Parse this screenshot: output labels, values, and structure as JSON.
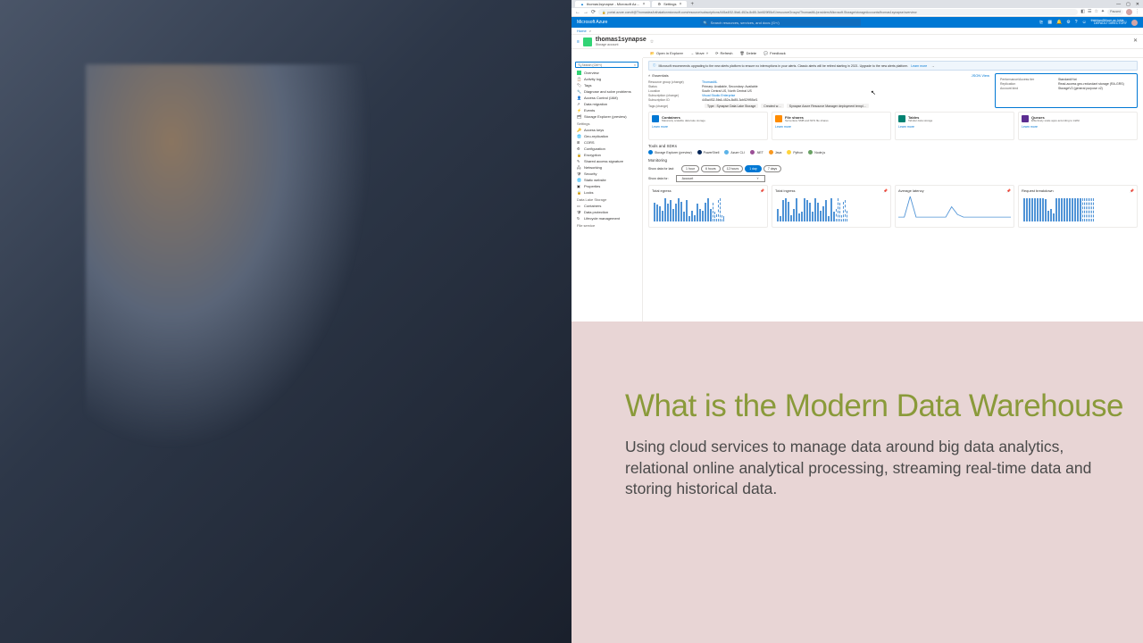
{
  "slide": {
    "headline": "What is the Modern Data Warehouse",
    "subhead": "Using cloud services to manage data around big data analytics, relational online analytical processing, streaming real-time data and storing historical data."
  },
  "browser": {
    "tab1": "thomas1synapse - Microsoft Az…",
    "tab2": "Settings",
    "url": "portal.azure.com/#@ThomasleaAnthalationmicrosoft.com/resource/subscriptions/445a4f32-5fa6-452a-8c85-3cb529f55cf1/resourceGroups/ThomasML/providers/Microsoft.Storage/storageAccounts/thomas1synapse/overview",
    "paused": "Paused"
  },
  "azure": {
    "brand": "Microsoft Azure",
    "search_ph": "Search resources, services, and docs (G+/)",
    "user_name": "thleblan@thom.ac-inbla…",
    "user_dir": "DEFAULT DIRECTORY"
  },
  "crumb": {
    "home": "Home",
    "sep": ">"
  },
  "resource": {
    "name": "thomas1synapse",
    "type": "Storage account"
  },
  "toolbar": {
    "open": "Open in Explorer",
    "move": "Move",
    "refresh": "Refresh",
    "delete": "Delete",
    "feedback": "Feedback"
  },
  "sidebar": {
    "search_ph": "Search (Ctrl+/)",
    "overview": "Overview",
    "activity": "Activity log",
    "tags": "Tags",
    "diagnose": "Diagnose and solve problems",
    "iam": "Access Control (IAM)",
    "migration": "Data migration",
    "events": "Events",
    "explorer": "Storage Explorer (preview)",
    "g_settings": "Settings",
    "keys": "Access keys",
    "geo": "Geo-replication",
    "cors": "CORS",
    "config": "Configuration",
    "encryption": "Encryption",
    "sas": "Shared access signature",
    "networking": "Networking",
    "security": "Security",
    "static": "Static website",
    "properties": "Properties",
    "locks": "Locks",
    "g_dls": "Data Lake Storage",
    "containers": "Containers",
    "dataprotect": "Data protection",
    "lifecycle": "Lifecycle management",
    "g_fs": "File service"
  },
  "alert": {
    "text": "Microsoft recommends upgrading to the new alerts platform to ensure no interruptions in your alerts. Classic alerts will be retired starting in 2021. Upgrade to the new alerts platform.",
    "link": "Learn more"
  },
  "essentials": {
    "header": "Essentials",
    "json": "JSON View",
    "rg_k": "Resource group (change)",
    "rg_v": "ThomasML",
    "status_k": "Status",
    "status_v": "Primary: Available, Secondary: Available",
    "loc_k": "Location",
    "loc_v": "South Central US, North Central US",
    "sub_k": "Subscription (change)",
    "sub_v": "Visual Studio Enterprise",
    "subid_k": "Subscription ID",
    "subid_v": "445a4f32-5fa6-452a-8c85-3cb529f55cf1",
    "tags_k": "Tags (change)",
    "tag1": "Type : Synapse Data Lake Storage",
    "tag2": "Created w…",
    "tag3": "Synapse Azure Resource Manager deployment templ…"
  },
  "callout": {
    "perf_k": "Performance/Access tier",
    "perf_v": "Standard/Hot",
    "repl_k": "Replication",
    "repl_v": "Read-access geo-redundant storage (RA-GRS)",
    "kind_k": "Account kind",
    "kind_v": "StorageV2 (general purpose v2)"
  },
  "cards": {
    "c1_t": "Containers",
    "c1_d": "Massively scalable data lake storage",
    "c1_l": "Learn more",
    "c2_t": "File shares",
    "c2_d": "Serverless SMB and NFS file shares",
    "c2_l": "Learn more",
    "c3_t": "Tables",
    "c3_d": "Tabular data storage",
    "c3_l": "Learn more",
    "c4_t": "Queues",
    "c4_d": "Effectively scale apps according to traffic",
    "c4_l": "Learn more"
  },
  "tools": {
    "header": "Tools and SDKs",
    "se": "Storage Explorer (preview)",
    "ps": "PowerShell",
    "cli": "Azure CLI",
    "net": ".NET",
    "java": "Java",
    "py": "Python",
    "node": "Node.js"
  },
  "monitoring": {
    "header": "Monitoring",
    "showlast": "Show data for last:",
    "t1": "1 hour",
    "t2": "6 hours",
    "t3": "12 hours",
    "t4": "1 day",
    "t5": "7 days",
    "showfor": "Show data for:",
    "agg": "Account"
  },
  "charts": {
    "c1": "Total egress",
    "c2": "Total ingress",
    "c3": "Average latency",
    "c4": "Request breakdown"
  },
  "chart_data": [
    {
      "type": "bar",
      "title": "Total egress",
      "values": [
        18,
        16,
        14,
        10,
        22,
        17,
        20,
        12,
        17,
        22,
        19,
        9,
        20,
        5,
        10,
        6,
        17,
        12,
        10,
        18,
        22,
        12,
        18,
        9,
        7,
        20,
        22,
        6,
        5
      ]
    },
    {
      "type": "bar",
      "title": "Total ingress",
      "values": [
        12,
        5,
        20,
        22,
        19,
        6,
        12,
        22,
        8,
        9,
        22,
        20,
        18,
        9,
        22,
        18,
        10,
        14,
        20,
        5,
        22,
        9,
        12,
        22,
        18,
        6,
        19,
        20,
        10
      ]
    },
    {
      "type": "line",
      "title": "Average latency",
      "values": [
        2,
        2,
        18,
        2,
        2,
        2,
        2,
        2,
        2,
        10,
        4,
        2,
        2,
        2,
        2,
        2,
        2,
        2,
        2,
        2
      ]
    },
    {
      "type": "bar",
      "title": "Request breakdown",
      "values": [
        22,
        22,
        22,
        22,
        22,
        22,
        22,
        22,
        21,
        10,
        12,
        8,
        22,
        22,
        22,
        22,
        22,
        22,
        22,
        22,
        22,
        22,
        22,
        22,
        22,
        22,
        22,
        22,
        22
      ]
    }
  ]
}
